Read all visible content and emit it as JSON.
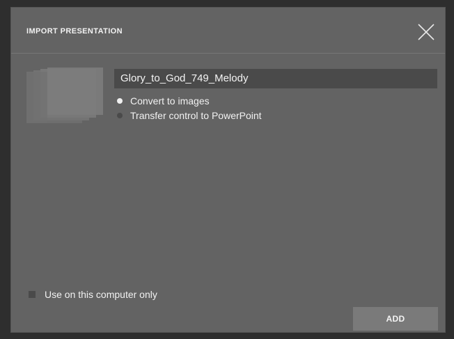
{
  "dialog": {
    "title": "IMPORT PRESENTATION",
    "close_icon": "close-icon"
  },
  "presentation": {
    "name": "Glory_to_God_749_Melody",
    "thumbnail_icon": "presentation-stack-icon"
  },
  "import_options": [
    {
      "label": "Convert to images",
      "selected": true
    },
    {
      "label": "Transfer control to PowerPoint",
      "selected": false
    }
  ],
  "local_only": {
    "label": "Use on this computer only",
    "checked": false
  },
  "actions": {
    "add_label": "ADD"
  },
  "colors": {
    "dialog_bg": "#636363",
    "field_bg": "#4a4a4a",
    "button_bg": "#7a7a7a",
    "text": "#f2f2f2"
  }
}
